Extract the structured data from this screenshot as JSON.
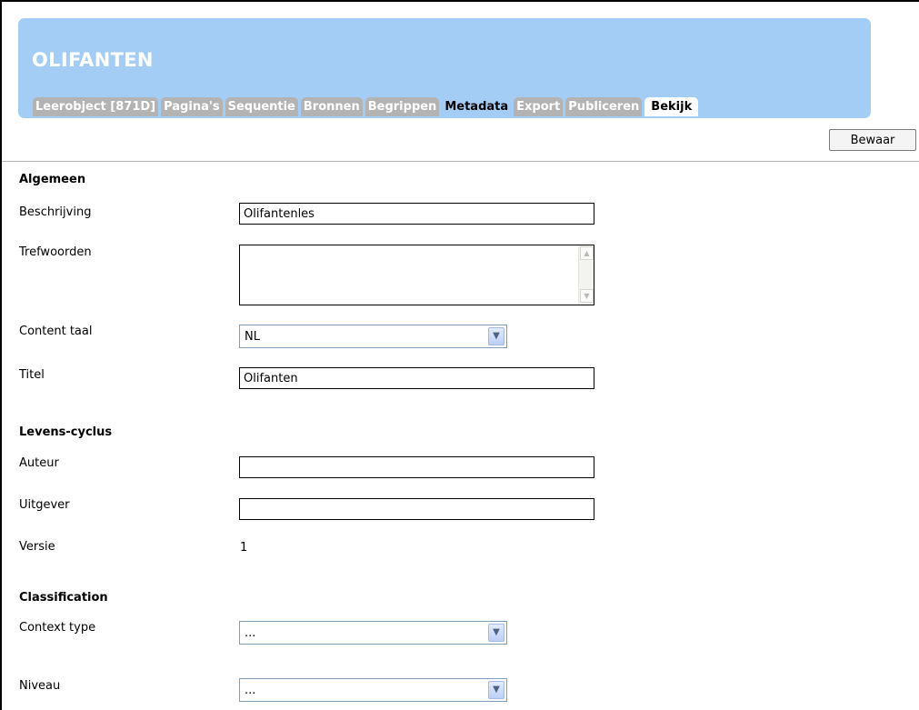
{
  "header": {
    "title": "OLIFANTEN",
    "tabs": [
      {
        "label": "Leerobject [871D]"
      },
      {
        "label": "Pagina's"
      },
      {
        "label": "Sequentie"
      },
      {
        "label": "Bronnen"
      },
      {
        "label": "Begrippen"
      },
      {
        "label": "Metadata"
      },
      {
        "label": "Export"
      },
      {
        "label": "Publiceren"
      },
      {
        "label": "Bekijk"
      }
    ],
    "active_tab": "Metadata"
  },
  "toolbar": {
    "save_label": "Bewaar"
  },
  "sections": {
    "algemeen": {
      "heading": "Algemeen",
      "beschrijving_label": "Beschrijving",
      "beschrijving_value": "Olifantenles",
      "trefwoorden_label": "Trefwoorden",
      "trefwoorden_value": "",
      "content_taal_label": "Content taal",
      "content_taal_value": "NL",
      "titel_label": "Titel",
      "titel_value": "Olifanten"
    },
    "levenscyclus": {
      "heading": "Levens-cyclus",
      "auteur_label": "Auteur",
      "auteur_value": "",
      "uitgever_label": "Uitgever",
      "uitgever_value": "",
      "versie_label": "Versie",
      "versie_value": "1"
    },
    "classification": {
      "heading": "Classification",
      "context_type_label": "Context type",
      "context_type_value": "...",
      "niveau_label": "Niveau",
      "niveau_value": "..."
    }
  },
  "icons": {
    "select_arrow": "chevron-down-icon",
    "scroll_up": "scroll-up-arrow-icon",
    "scroll_down": "scroll-down-arrow-icon"
  },
  "colors": {
    "banner": "#a3cdf5",
    "tab_inactive": "#b3b3b3",
    "tab_active": "#a3cdf5",
    "title_text": "#ffffff"
  }
}
